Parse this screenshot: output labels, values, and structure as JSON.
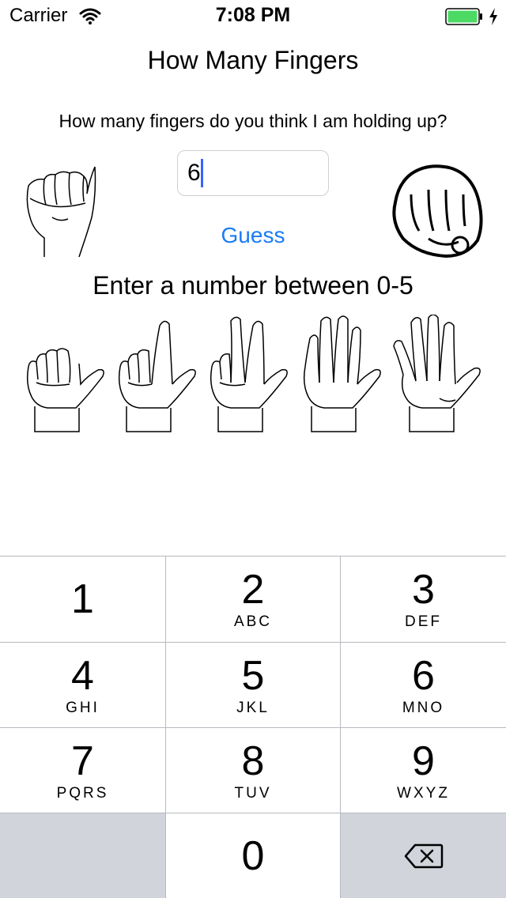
{
  "status_bar": {
    "carrier": "Carrier",
    "time": "7:08 PM",
    "wifi_icon": "wifi-icon",
    "battery_icon": "battery-icon",
    "battery_color": "#4cd964"
  },
  "header": {
    "title": "How Many Fingers"
  },
  "main": {
    "question": "How many fingers do you think I am holding up?",
    "guess_value": "6",
    "guess_button": "Guess",
    "instruction": "Enter a number between 0-5",
    "accent_color": "#1a7cf5"
  },
  "keypad": {
    "keys": [
      {
        "digit": "1",
        "letters": ""
      },
      {
        "digit": "2",
        "letters": "ABC"
      },
      {
        "digit": "3",
        "letters": "DEF"
      },
      {
        "digit": "4",
        "letters": "GHI"
      },
      {
        "digit": "5",
        "letters": "JKL"
      },
      {
        "digit": "6",
        "letters": "MNO"
      },
      {
        "digit": "7",
        "letters": "PQRS"
      },
      {
        "digit": "8",
        "letters": "TUV"
      },
      {
        "digit": "9",
        "letters": "WXYZ"
      },
      {
        "digit": "0",
        "letters": ""
      }
    ],
    "delete_icon": "backspace-icon"
  }
}
